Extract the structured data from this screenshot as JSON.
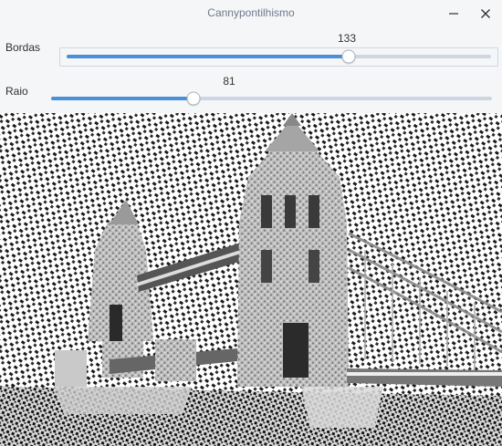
{
  "window": {
    "title": "Cannypontilhismo"
  },
  "controls": {
    "bordas": {
      "label": "Bordas",
      "value": 133,
      "min": 0,
      "max": 200
    },
    "raio": {
      "label": "Raio",
      "value": 81,
      "min": 0,
      "max": 250
    }
  },
  "colors": {
    "accent": "#4a90d9",
    "track": "#cdd6e3",
    "title": "#6e7a8c"
  },
  "icons": {
    "minimize": "minimize-icon",
    "close": "close-icon"
  }
}
